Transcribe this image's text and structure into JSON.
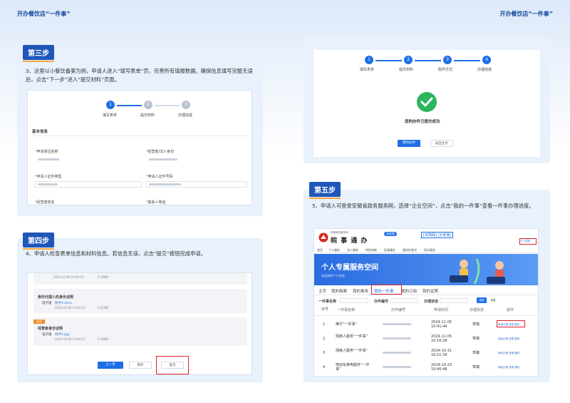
{
  "header": {
    "left_title": "开办餐饮店“一件事”",
    "right_title": "开办餐饮店“一件事”"
  },
  "step3": {
    "title": "第三步",
    "desc": "3、这里以小餐饮备案为例，申请人进入“填写表单”页，完善所有填报数据。确保信息填写完整无误后，点击“下一步”进入“提交材料”页面。",
    "steps": [
      "填写表单",
      "提交材料",
      "办理完成"
    ],
    "section": "基本信息",
    "fields": [
      "申请单位名称",
      "经营者/法人身份",
      "申请人证件类型",
      "申请人证件号码",
      "经营者姓名",
      "联系人电话"
    ]
  },
  "step4": {
    "title": "第四步",
    "desc": "4、申请人检查表单信息和材料信息。若信息无误，点击“提交”按钮完成申请。",
    "box1_time": "2024-10-08 10:49:19",
    "box1_size": "0.19MB",
    "box2_title": "委托代理人的身份证明",
    "box2_label": "电子版",
    "box2_file": "附件4.docx",
    "box2_time": "2024-10-08 10:49:19",
    "box2_size": "0.01MB",
    "box3_tag": "必须",
    "box3_title": "经营者身份证明",
    "box3_label": "电子版",
    "box3_file": "附件2.jpg",
    "box3_time": "2024-10-08 10:49:21",
    "box3_size": "0.18MB",
    "btn_prev": "上一步",
    "btn_save": "暂存",
    "btn_submit": "提交"
  },
  "right_top": {
    "steps": [
      "填写表单",
      "提交材料",
      "取件方式",
      "办理完成"
    ],
    "success": "您的办件已提交成功",
    "btn1": "我的办件",
    "btn2": "返回主页"
  },
  "step5": {
    "title": "第五步",
    "desc": "5、申请人可登录安徽省政务服务网，选择“企业空间”，点击“我的一件事”查看一件事办理进度。",
    "portal_name": "皖 事 通 办",
    "portal_sub": "安徽政务服务网",
    "portal_badge": "适老版",
    "region": "[无障碍] [长者版]",
    "nav": [
      "首页",
      "个人服务",
      "法人服务",
      "特色创新",
      "区域通办",
      "服务好差评",
      "阳光政务"
    ],
    "user_btn": "个人空间",
    "banner_title": "个人专属服务空间",
    "banner_sub": "欢迎来到个人空间！",
    "tabs": [
      "主页",
      "我的档案",
      "我的事务",
      "我的一件事",
      "我的订阅",
      "我的证照"
    ],
    "filters": [
      "一件事名称",
      "办件编号",
      "办理状态"
    ],
    "filter_btn": "查询",
    "filter_reset": "重置",
    "columns": [
      "序号",
      "一件事名称",
      "办件编号",
      "申请时间",
      "办理状态",
      "操作"
    ],
    "rows": [
      {
        "no": "1",
        "name": "推行“一件事”",
        "time": "2024-11-05 10:41:44",
        "status": "草稿"
      },
      {
        "no": "2",
        "name": "残疾人服务“一件事”",
        "time": "2024-11-05 10:16:28",
        "status": "草稿"
      },
      {
        "no": "3",
        "name": "残疾人服务“一件事”",
        "time": "2024-10-31 16:21:34",
        "status": "草稿"
      },
      {
        "no": "4",
        "name": "电动车换电服务“一件事”",
        "time": "2024-10-23 19:46:48",
        "status": "草稿"
      }
    ],
    "ops": "继续办理 查看 删除"
  },
  "colors": {
    "accent": "#1f56b8",
    "blue": "#1f6fe5",
    "orange": "#f2a93b",
    "success": "#2db55d",
    "red": "#e0202a"
  }
}
